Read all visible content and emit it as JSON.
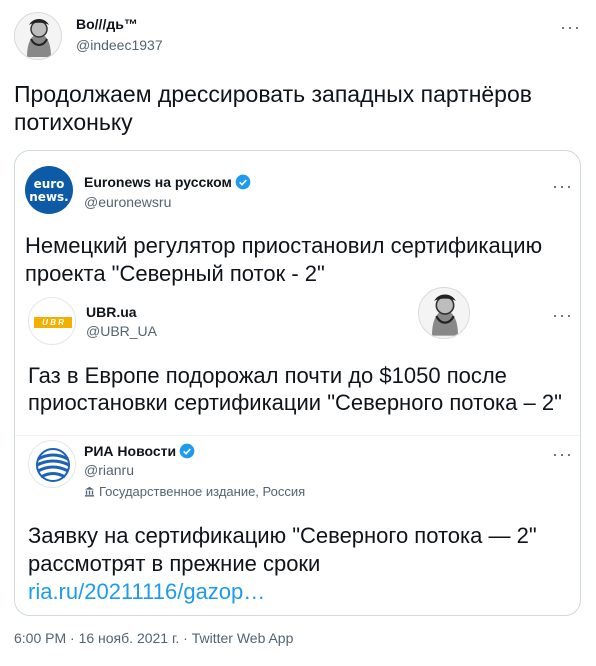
{
  "main_tweet": {
    "author_name": "Во///дь™",
    "author_handle": "@indeec1937",
    "text": "Продолжаем дрессировать западных партнёров потихоньку",
    "more_icon": "more-options-icon",
    "timestamp": "6:00 PM · 16 нояб. 2021 г. · Twitter Web App"
  },
  "quoted_tweet": {
    "author_name": "Euronews на русском",
    "author_handle": "@euronewsru",
    "avatar_lines": [
      "euro",
      "news."
    ],
    "verified": true,
    "text": "Немецкий регулятор приостановил сертификацию проекта \"Северный поток - 2\""
  },
  "nested_ubr": {
    "author_name": "UBR.ua",
    "author_handle": "@UBR_UA",
    "logo_text": "U B R",
    "text": "Газ в Европе подорожал почти до $1050 после приостановки сертификации \"Северного потока – 2\""
  },
  "nested_ria": {
    "author_name": "РИА Новости",
    "author_handle": "@rianru",
    "verified": true,
    "label": "Государственное издание, Россия",
    "text": "Заявку на сертификацию \"Северного потока — 2\" рассмотрят в прежние сроки",
    "link": "ria.ru/20211116/gazop…"
  },
  "colors": {
    "accent_blue": "#1d9bf0",
    "secondary_text": "#536471",
    "border": "#cfd9de",
    "euronews_blue": "#0d5aa7",
    "ubr_yellow": "#f3b000"
  }
}
